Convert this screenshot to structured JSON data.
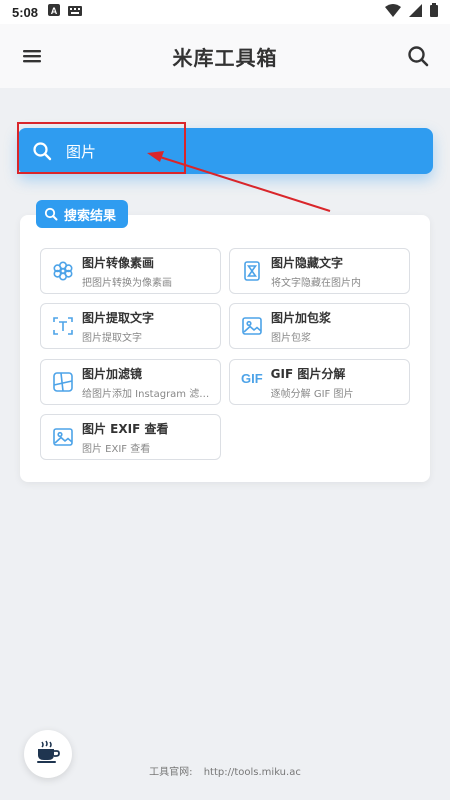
{
  "status_bar": {
    "time": "5:08"
  },
  "app_bar": {
    "title": "米库工具箱"
  },
  "search": {
    "value": "图片",
    "placeholder": ""
  },
  "results": {
    "label": "搜索结果",
    "items": [
      {
        "title": "图片转像素画",
        "desc": "把图片转换为像素画",
        "icon": "flower-icon"
      },
      {
        "title": "图片隐藏文字",
        "desc": "将文字隐藏在图片内",
        "icon": "hourglass-icon"
      },
      {
        "title": "图片提取文字",
        "desc": "图片提取文字",
        "icon": "text-scan-icon"
      },
      {
        "title": "图片加包浆",
        "desc": "图片包浆",
        "icon": "image-icon"
      },
      {
        "title": "图片加滤镜",
        "desc": "给图片添加 Instagram 滤…",
        "icon": "filter-icon"
      },
      {
        "title": "GIF 图片分解",
        "desc": "逐帧分解 GIF 图片",
        "icon": "gif-icon",
        "icon_text": "GIF"
      },
      {
        "title": "图片 EXIF 查看",
        "desc": "图片 EXIF 查看",
        "icon": "image-icon"
      }
    ]
  },
  "footer": {
    "label": "工具官网:",
    "url": "http://tools.miku.ac"
  },
  "colors": {
    "accent": "#2f9cf0",
    "annotation": "#d9262b",
    "icon": "#4da3e8"
  }
}
